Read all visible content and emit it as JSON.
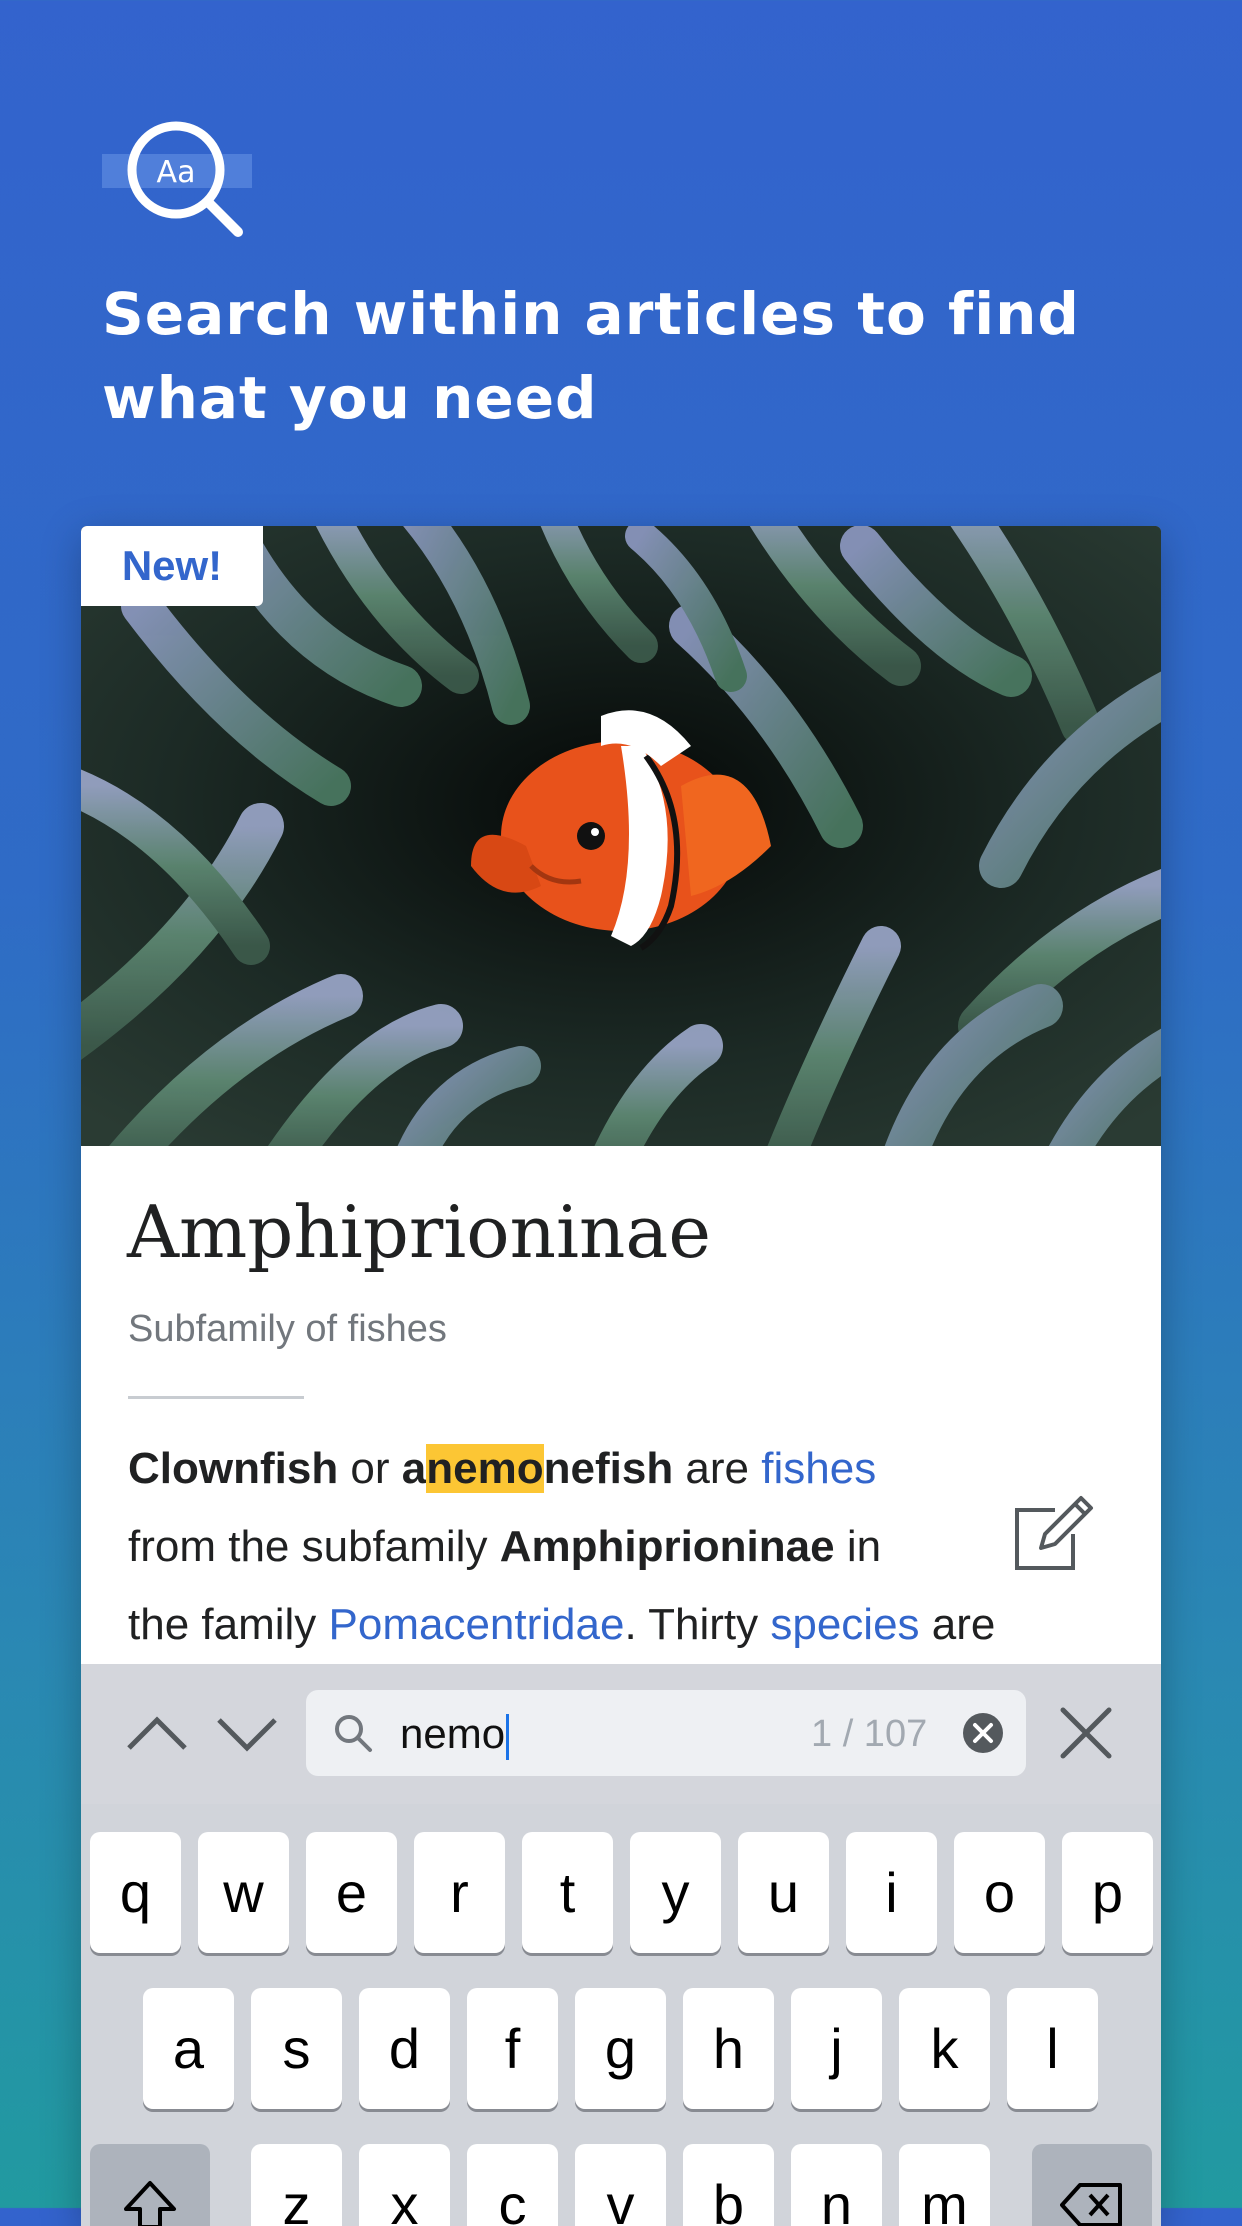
{
  "headline": {
    "line1": "Search within articles to find",
    "line2": "what you need"
  },
  "card": {
    "badge": "New!",
    "article": {
      "title": "Amphiprioninae",
      "subtitle": "Subfamily of fishes",
      "p1": {
        "w1": "Clownfish",
        "w2": " or ",
        "w3a": "a",
        "w3hl": "nemo",
        "w3b": "nefish",
        "w4": " are ",
        "w5": "fishes"
      },
      "p2": {
        "w1": "from the subfamily ",
        "w2": "Amphiprioninae",
        "w3": " in"
      },
      "p3": {
        "w1": "the family ",
        "w2": "Pomacentridae",
        "w3": ". Thirty ",
        "w4": "species",
        "w5": " are"
      }
    }
  },
  "find": {
    "query": "nemo",
    "count": "1 / 107"
  },
  "keyboard": {
    "row1": [
      "q",
      "w",
      "e",
      "r",
      "t",
      "y",
      "u",
      "i",
      "o",
      "p"
    ],
    "row2": [
      "a",
      "s",
      "d",
      "f",
      "g",
      "h",
      "j",
      "k",
      "l"
    ],
    "row3": [
      "z",
      "x",
      "c",
      "v",
      "b",
      "n",
      "m"
    ]
  },
  "colors": {
    "accent": "#3366cc",
    "highlight": "#fcc634",
    "fish_orange": "#e8521b"
  },
  "icons": {
    "hero": "text-search-icon",
    "edit": "edit-pencil-icon",
    "prev": "chevron-up-icon",
    "next": "chevron-down-icon",
    "search": "search-icon",
    "clear": "clear-circle-icon",
    "close": "close-icon"
  }
}
